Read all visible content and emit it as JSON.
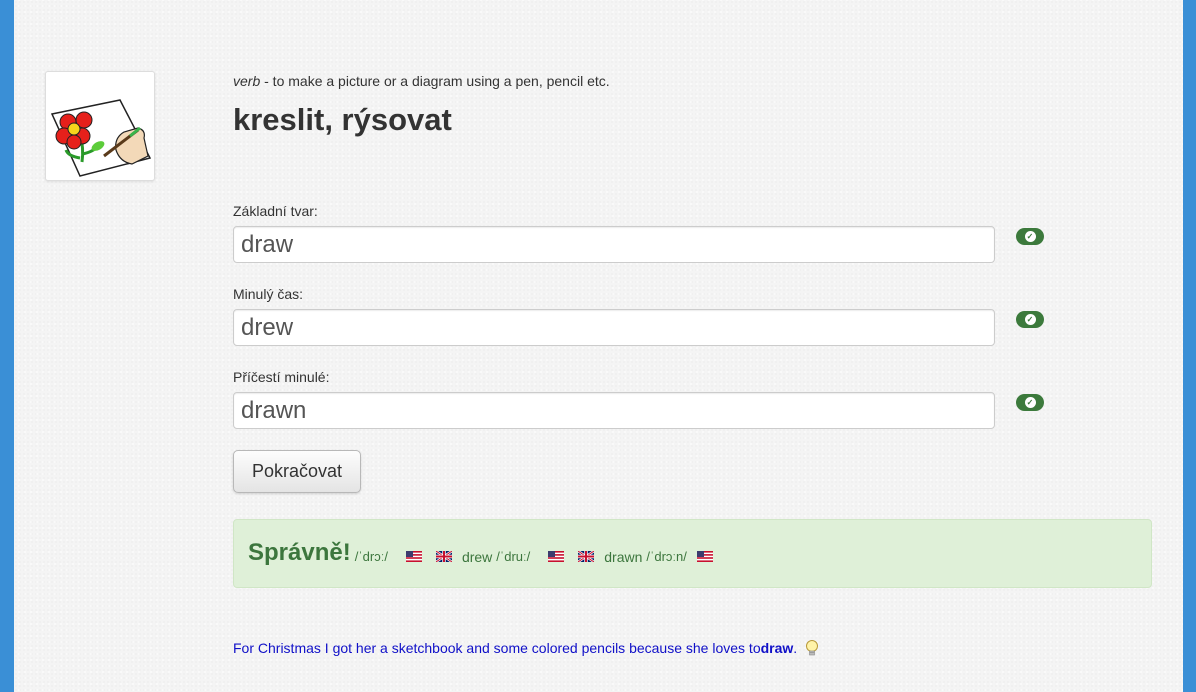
{
  "entry": {
    "part_of_speech": "verb",
    "definition": " - to make a picture or a diagram using a pen, pencil etc.",
    "translation": "kreslit, rýsovat",
    "image_icon": "drawing-flower-icon"
  },
  "form": {
    "fields": [
      {
        "label": "Základní tvar:",
        "value": "draw",
        "status": "correct"
      },
      {
        "label": "Minulý čas:",
        "value": "drew",
        "status": "correct"
      },
      {
        "label": "Příčestí minulé:",
        "value": "drawn",
        "status": "correct"
      }
    ],
    "continue_label": "Pokračovat"
  },
  "result": {
    "title": "Správně!",
    "pron1_ipa": "/ˈdrɔː/",
    "word2": "drew",
    "pron2_ipa": "/ˈdruː/",
    "word3": "drawn",
    "pron3_ipa": "/ˈdrɔːn/",
    "flag_us": "us-flag-icon",
    "flag_uk": "uk-flag-icon"
  },
  "example": {
    "text_before": "For Christmas I got her a sketchbook and some colored pencils because she loves to ",
    "highlight": "draw",
    "text_after": ".",
    "hint_icon": "lightbulb-icon"
  },
  "colors": {
    "page_border": "#3a8fd6",
    "success_green": "#3c763d",
    "success_bg": "#dff0d8",
    "example_text": "#1010c8"
  }
}
